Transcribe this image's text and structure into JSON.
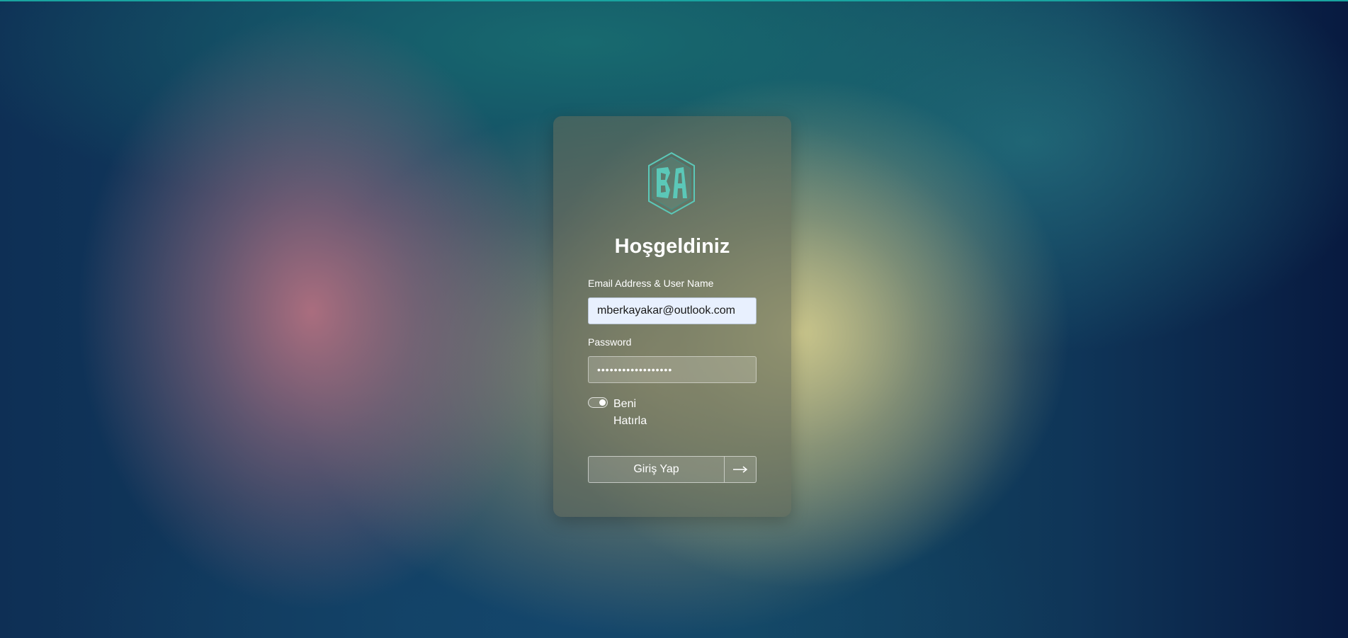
{
  "login": {
    "title": "Hoşgeldiniz",
    "email_label": "Email Address & User Name",
    "email_value": "mberkayakar@outlook.com",
    "password_label": "Password",
    "password_value": "••••••••••••••••••",
    "remember_label": "Beni Hatırla",
    "remember_checked": true,
    "submit_label": "Giriş Yap",
    "logo_text": "BA"
  },
  "icons": {
    "logo": "ba-hexagon-logo-icon",
    "submit_arrow": "arrow-right-icon"
  },
  "colors": {
    "accent": "#5bc8b8",
    "top_line": "#19a4a0",
    "input_autofill_bg": "#e8f0fe"
  }
}
